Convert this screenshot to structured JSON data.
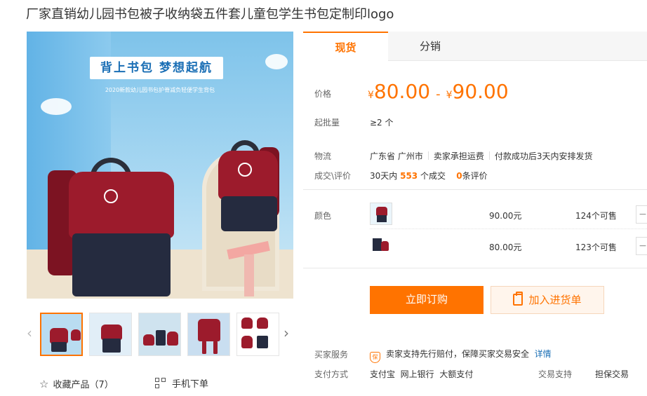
{
  "title": "厂家直销幼儿园书包被子收纳袋五件套儿童包学生书包定制印logo",
  "main_image": {
    "headline": "背上书包  梦想起航",
    "subtitle": "2020新款幼儿园书包护脊减负轻便学生背包"
  },
  "thumbs_count": 5,
  "actions": {
    "favorite": "收藏产品（7）",
    "mobile_order": "手机下单"
  },
  "tabs": [
    "现货",
    "分销"
  ],
  "price": {
    "label": "价格",
    "currency": "¥",
    "low": "80.00",
    "dash": "-",
    "high": "90.00"
  },
  "moq": {
    "label": "起批量",
    "value": "≥2 个"
  },
  "logistics": {
    "label": "物流",
    "origin": "广东省 广州市",
    "freight": "卖家承担运费",
    "ship": "付款成功后3天内安排发货"
  },
  "deals": {
    "label": "成交\\评价",
    "prefix": "30天内",
    "count": "553",
    "count_suffix": "个成交",
    "reviews": "0",
    "reviews_suffix": "条评价"
  },
  "color": {
    "label": "颜色",
    "options": [
      {
        "price": "90.00元",
        "stock": "124个可售",
        "stepper": "−"
      },
      {
        "price": "80.00元",
        "stock": "123个可售",
        "stepper": "−"
      }
    ]
  },
  "buttons": {
    "buy": "立即订购",
    "cart": "加入进货单"
  },
  "service": {
    "label": "买家服务",
    "badge": "保",
    "text": "卖家支持先行赔付，保障买家交易安全",
    "detail": "详情"
  },
  "payment": {
    "label": "支付方式",
    "methods": [
      "支付宝",
      "网上银行",
      "大额支付"
    ],
    "trade_label": "交易支持",
    "trade_value": "担保交易"
  },
  "colors": {
    "accent": "#ff7300",
    "link": "#1b6fb5"
  }
}
